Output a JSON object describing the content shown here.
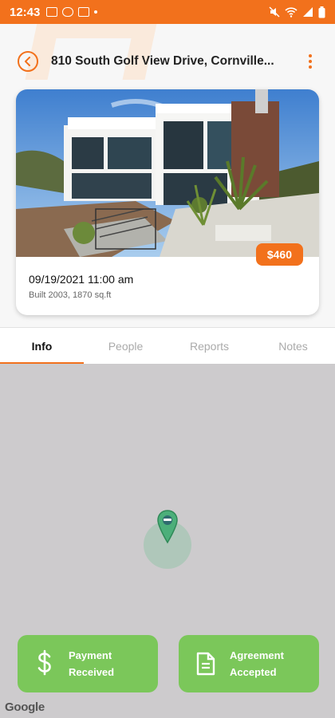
{
  "status_bar": {
    "time": "12:43",
    "color": "#f2711c"
  },
  "header": {
    "address": "810 South Golf View Drive, Cornville...",
    "back_icon": "chevron-left-icon",
    "menu_icon": "kebab-menu-icon"
  },
  "property_card": {
    "price": "$460",
    "datetime": "09/19/2021 11:00 am",
    "details": "Built 2003, 1870 sq.ft"
  },
  "tabs": [
    {
      "label": "Info",
      "active": true
    },
    {
      "label": "People",
      "active": false
    },
    {
      "label": "Reports",
      "active": false
    },
    {
      "label": "Notes",
      "active": false
    }
  ],
  "map": {
    "attribution": "Google"
  },
  "actions": {
    "payment": {
      "line1": "Payment",
      "line2": "Received",
      "icon": "dollar-icon"
    },
    "agreement": {
      "line1": "Agreement",
      "line2": "Accepted",
      "icon": "document-icon"
    }
  },
  "colors": {
    "accent": "#f2711c",
    "action_green": "#7bc75a",
    "map_bg": "#cdcbcd"
  }
}
